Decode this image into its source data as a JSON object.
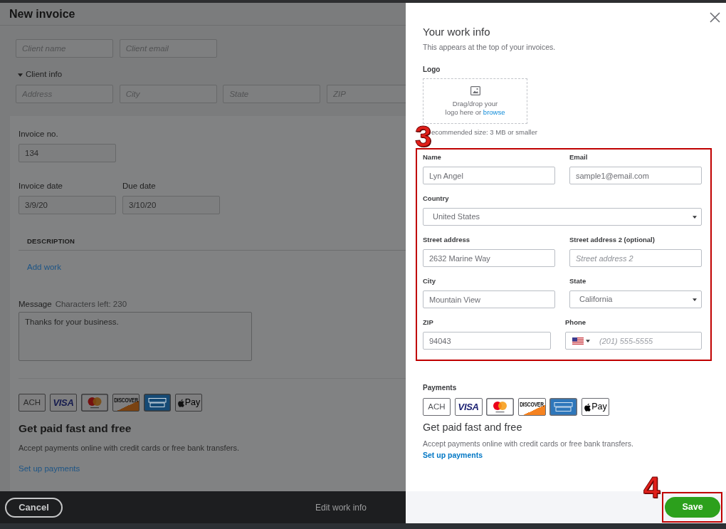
{
  "invoice": {
    "title": "New invoice",
    "client_fields": [
      {
        "placeholder": "Client name"
      },
      {
        "placeholder": "Client email"
      }
    ],
    "client_info": {
      "label": "Client info",
      "expanded": true,
      "fields": [
        {
          "placeholder": "Address"
        },
        {
          "placeholder": "City"
        },
        {
          "placeholder": "State"
        },
        {
          "placeholder": "ZIP"
        }
      ]
    },
    "invoice_no": {
      "label": "Invoice no.",
      "value": "134"
    },
    "dates": [
      {
        "label": "Invoice date",
        "value": "3/9/20"
      },
      {
        "label": "Due date",
        "value": "3/10/20"
      }
    ],
    "table": {
      "columns": [
        "DESCRIPTION"
      ],
      "add_link": "Add work"
    },
    "message": {
      "label": "Message",
      "counter": "Characters left: 230",
      "value": "Thanks for your business."
    },
    "payments": {
      "methods": [
        {
          "kind": "wordmark",
          "label": "ACH"
        },
        {
          "kind": "visa",
          "label": "VISA"
        },
        {
          "kind": "mastercard"
        },
        {
          "kind": "discover",
          "label": "DISCOVER"
        },
        {
          "kind": "amex"
        },
        {
          "kind": "applepay",
          "label": "Pay"
        }
      ],
      "heading": "Get paid fast and free",
      "text": "Accept payments online with credit cards or free bank transfers.",
      "link": "Set up payments"
    }
  },
  "footer": {
    "cancel": "Cancel",
    "step": "Edit work info"
  },
  "drawer": {
    "title": "Your work info",
    "subtitle": "This appears at the top of your invoices.",
    "logo": {
      "label": "Logo",
      "hint_lines": [
        "Drag/drop your",
        "logo here or"
      ],
      "browse": "browse",
      "note": "ecommended size: 3 MB or smaller"
    },
    "work_form": {
      "annotation": "3",
      "rows": [
        [
          {
            "label": "Name",
            "kind": "text",
            "value": "Lyn Angel"
          },
          {
            "label": "Email",
            "kind": "text",
            "value": "sample1@email.com"
          }
        ],
        [
          {
            "label": "Country",
            "kind": "select",
            "value": "United States"
          }
        ],
        [
          {
            "label": "Street address",
            "kind": "text",
            "value": "2632 Marine Way"
          },
          {
            "label": "Street address 2 (optional)",
            "kind": "text",
            "placeholder": "Street address 2"
          }
        ],
        [
          {
            "label": "City",
            "kind": "text",
            "value": "Mountain View"
          },
          {
            "label": "State",
            "kind": "select",
            "value": "California"
          }
        ],
        [
          {
            "label": "ZIP",
            "kind": "text",
            "value": "94043"
          },
          {
            "label": "Phone",
            "kind": "phone",
            "placeholder": "(201) 555-5555"
          }
        ]
      ]
    },
    "payments": {
      "label": "Payments",
      "methods": [
        {
          "kind": "wordmark",
          "label": "ACH"
        },
        {
          "kind": "visa",
          "label": "VISA"
        },
        {
          "kind": "mastercard"
        },
        {
          "kind": "discover",
          "label": "DISCOVER"
        },
        {
          "kind": "amex"
        },
        {
          "kind": "applepay",
          "label": "Pay"
        }
      ],
      "heading": "Get paid fast and free",
      "text": "Accept payments online with credit cards or free bank transfers.",
      "link": "Set up payments"
    },
    "save": {
      "label": "Save",
      "annotation": "4"
    }
  }
}
